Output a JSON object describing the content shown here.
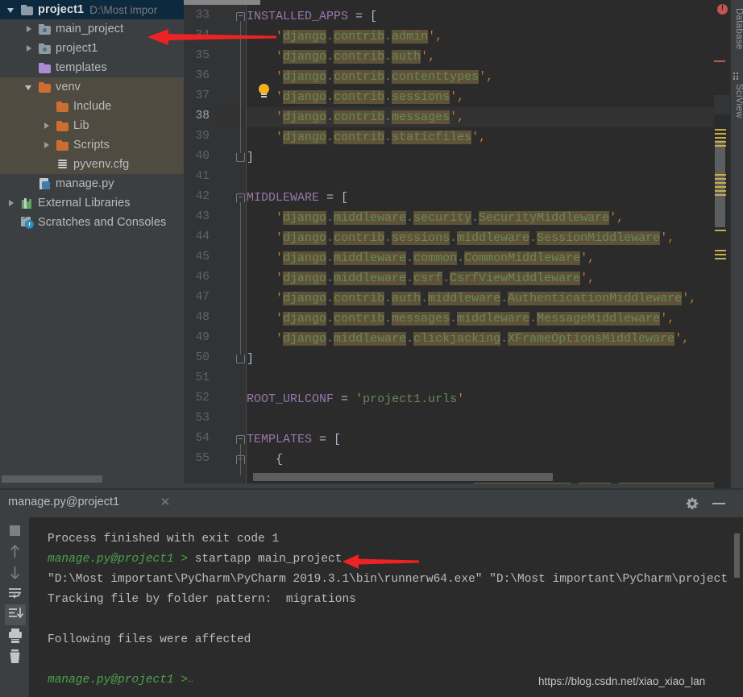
{
  "project_panel": {
    "root": {
      "label": "project1",
      "path": "D:\\Most impor",
      "icon": "folder-icon",
      "expanded": true,
      "selected": true
    },
    "items": [
      {
        "label": "main_project",
        "icon": "module-folder-icon",
        "twisty": "right",
        "indent": 1
      },
      {
        "label": "project1",
        "icon": "module-folder-icon",
        "twisty": "right",
        "indent": 1
      },
      {
        "label": "templates",
        "icon": "template-folder-icon",
        "twisty": "none",
        "indent": 1
      },
      {
        "label": "venv",
        "icon": "venv-folder-icon",
        "twisty": "down",
        "indent": 1
      },
      {
        "label": "Include",
        "icon": "venv-folder-icon",
        "twisty": "none",
        "indent": 2
      },
      {
        "label": "Lib",
        "icon": "venv-folder-icon",
        "twisty": "right",
        "indent": 2
      },
      {
        "label": "Scripts",
        "icon": "venv-folder-icon",
        "twisty": "right",
        "indent": 2
      },
      {
        "label": "pyvenv.cfg",
        "icon": "config-file-icon",
        "twisty": "none",
        "indent": 2
      },
      {
        "label": "manage.py",
        "icon": "python-file-icon",
        "twisty": "none",
        "indent": 1
      },
      {
        "label": "External Libraries",
        "icon": "library-icon",
        "twisty": "right",
        "indent": 0
      },
      {
        "label": "Scratches and Consoles",
        "icon": "scratches-icon",
        "twisty": "none",
        "indent": 0
      }
    ]
  },
  "editor": {
    "lines": [
      {
        "no": "33",
        "text": "INSTALLED_APPS = ["
      },
      {
        "no": "34",
        "text": "    'django.contrib.admin',"
      },
      {
        "no": "35",
        "text": "    'django.contrib.auth',"
      },
      {
        "no": "36",
        "text": "    'django.contrib.contenttypes',"
      },
      {
        "no": "37",
        "text": "    'django.contrib.sessions',"
      },
      {
        "no": "38",
        "text": "    'django.contrib.messages',"
      },
      {
        "no": "39",
        "text": "    'django.contrib.staticfiles',"
      },
      {
        "no": "40",
        "text": "]"
      },
      {
        "no": "41",
        "text": ""
      },
      {
        "no": "42",
        "text": "MIDDLEWARE = ["
      },
      {
        "no": "43",
        "text": "    'django.middleware.security.SecurityMiddleware',"
      },
      {
        "no": "44",
        "text": "    'django.contrib.sessions.middleware.SessionMiddleware',"
      },
      {
        "no": "45",
        "text": "    'django.middleware.common.CommonMiddleware',"
      },
      {
        "no": "46",
        "text": "    'django.middleware.csrf.CsrfViewMiddleware',"
      },
      {
        "no": "47",
        "text": "    'django.contrib.auth.middleware.AuthenticationMiddleware',"
      },
      {
        "no": "48",
        "text": "    'django.contrib.messages.middleware.MessageMiddleware',"
      },
      {
        "no": "49",
        "text": "    'django.middleware.clickjacking.XFrameOptionsMiddleware',"
      },
      {
        "no": "50",
        "text": "]"
      },
      {
        "no": "51",
        "text": ""
      },
      {
        "no": "52",
        "text": "ROOT_URLCONF = 'project1.urls'"
      },
      {
        "no": "53",
        "text": ""
      },
      {
        "no": "54",
        "text": "TEMPLATES = ["
      },
      {
        "no": "55",
        "text": "    {"
      }
    ],
    "current_line": "38",
    "intention_bulb": "lightbulb-icon",
    "error_badge": "error-indicator-icon"
  },
  "right_tool_window_bar": {
    "buttons": [
      {
        "label": "Database",
        "icon": "database-icon"
      },
      {
        "label": "SciView",
        "icon": "sciview-grid-icon"
      }
    ]
  },
  "run_panel": {
    "tab_title": "manage.py@project1",
    "close_icon": "close-icon",
    "settings_icon": "gear-icon",
    "minimize_icon": "minimize-icon",
    "toolbar": [
      {
        "icon": "stop-icon",
        "active": false
      },
      {
        "icon": "up-arrow-icon",
        "active": false
      },
      {
        "icon": "down-arrow-icon",
        "active": false
      },
      {
        "icon": "soft-wrap-icon",
        "active": false
      },
      {
        "icon": "scroll-to-end-icon",
        "active": true
      },
      {
        "icon": "print-icon",
        "active": false
      },
      {
        "icon": "trash-icon",
        "active": false
      }
    ],
    "console_lines": [
      {
        "kind": "plain",
        "text": "Process finished with exit code 1"
      },
      {
        "kind": "prompt",
        "prefix": "manage.py@project1 >",
        "command": " startapp main_project"
      },
      {
        "kind": "plain",
        "text": "\"D:\\Most important\\PyCharm\\PyCharm 2019.3.1\\bin\\runnerw64.exe\" \"D:\\Most important\\PyCharm\\project"
      },
      {
        "kind": "plain",
        "text": "Tracking file by folder pattern:  migrations"
      },
      {
        "kind": "plain",
        "text": ""
      },
      {
        "kind": "plain",
        "text": "Following files were affected"
      },
      {
        "kind": "plain",
        "text": ""
      },
      {
        "kind": "prompt",
        "prefix": "manage.py@project1 >",
        "command": ""
      }
    ]
  },
  "watermark": {
    "text": "https://blog.csdn.net/xiao_xiao_lan"
  },
  "annotations": {
    "arrows": [
      {
        "name": "arrow-pointing-to-main-project",
        "color": "#EE2222"
      },
      {
        "name": "arrow-pointing-to-startapp-command",
        "color": "#EE2222"
      }
    ]
  },
  "colors": {
    "editor_bg": "#2B2B2B",
    "panel_bg": "#3C3F41",
    "gutter_bg": "#313335",
    "string_fg": "#6A8759",
    "highlight_bg": "#5E5338",
    "selection_bg": "#0D293E",
    "scope_bg": "#4F4B41",
    "accent_red": "#C75450",
    "prompt_green": "#4BA34B"
  }
}
